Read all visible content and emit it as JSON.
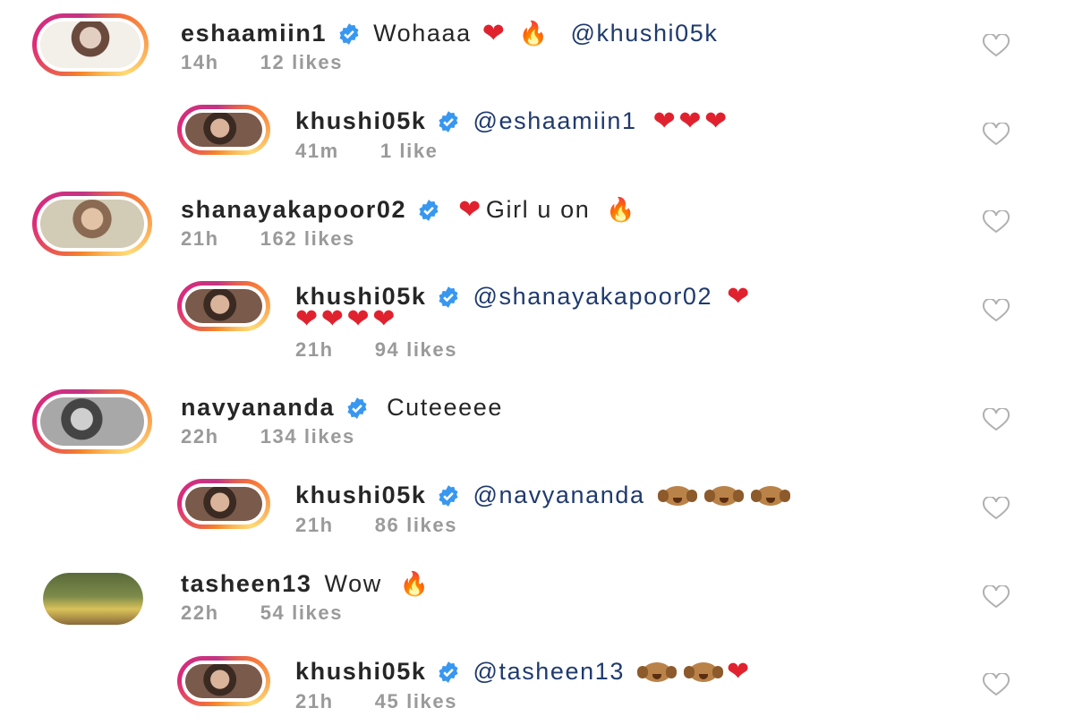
{
  "comments": [
    {
      "user": "eshaamiin1",
      "text": "Wohaaa",
      "emoji_after_text": [
        "heart",
        "fire"
      ],
      "mention": "@khushi05k",
      "emoji_after_mention": [],
      "time": "14h",
      "likes": "12 likes"
    },
    {
      "user": "khushi05k",
      "text": "",
      "emoji_after_text": [],
      "mention": "@eshaamiin1",
      "emoji_after_mention": [
        "heart",
        "heart",
        "heart"
      ],
      "time": "41m",
      "likes": "1 like"
    },
    {
      "user": "shanayakapoor02",
      "text": "Girl u on",
      "emoji_after_text": [
        "fire"
      ],
      "mention": "",
      "emoji_after_mention": [],
      "time": "21h",
      "likes": "162 likes"
    },
    {
      "user": "khushi05k",
      "text": "",
      "emoji_after_text": [],
      "mention": "@shanayakapoor02",
      "emoji_after_mention": [
        "heart",
        "heart",
        "heart",
        "heart",
        "heart"
      ],
      "time": "21h",
      "likes": "94 likes"
    },
    {
      "user": "navyananda",
      "text": "Cuteeeee",
      "emoji_after_text": [],
      "mention": "",
      "emoji_after_mention": [],
      "time": "22h",
      "likes": "134 likes"
    },
    {
      "user": "khushi05k",
      "text": "",
      "emoji_after_text": [],
      "mention": "@navyananda",
      "emoji_after_mention": [
        "speak-no-evil-monkey",
        "speak-no-evil-monkey",
        "speak-no-evil-monkey"
      ],
      "time": "21h",
      "likes": "86 likes"
    },
    {
      "user": "tasheen13",
      "text": "Wow",
      "emoji_after_text": [
        "fire"
      ],
      "mention": "",
      "emoji_after_mention": [],
      "time": "22h",
      "likes": "54 likes"
    },
    {
      "user": "khushi05k",
      "text": "",
      "emoji_after_text": [],
      "mention": "@tasheen13",
      "emoji_after_mention": [
        "speak-no-evil-monkey",
        "speak-no-evil-monkey",
        "heart"
      ],
      "time": "21h",
      "likes": "45 likes"
    }
  ],
  "colors": {
    "verified": "#3897f0",
    "heart": "#e0222f",
    "fire": "#f07b13",
    "meta": "#9a9a9a",
    "mention": "#1f3a6e"
  }
}
